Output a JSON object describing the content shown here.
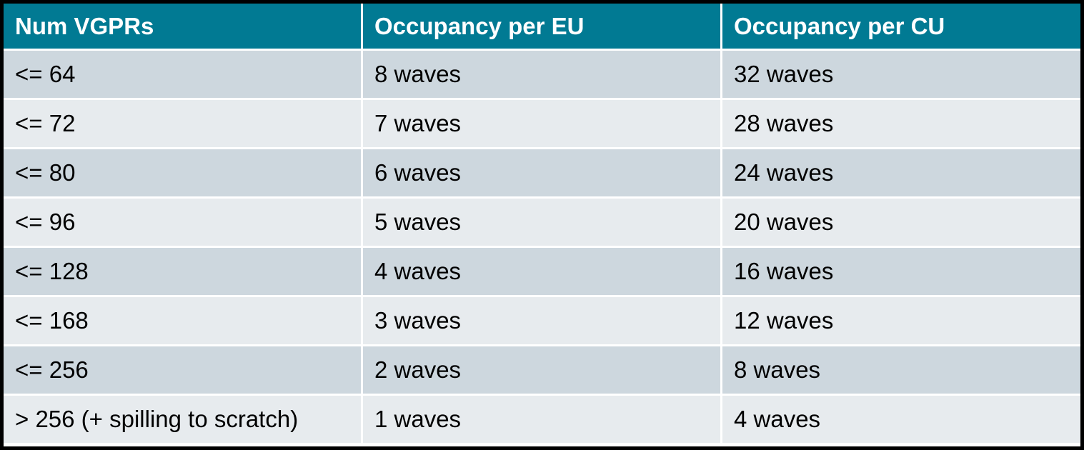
{
  "table": {
    "header_color": "#017A93",
    "row_color_dark": "#CDD7DE",
    "row_color_light": "#E7EBEE",
    "columns": [
      "Num VGPRs",
      "Occupancy per EU",
      "Occupancy per CU"
    ],
    "rows": [
      [
        "<= 64",
        "8 waves",
        "32 waves"
      ],
      [
        "<= 72",
        "7 waves",
        "28 waves"
      ],
      [
        "<= 80",
        "6 waves",
        "24 waves"
      ],
      [
        "<= 96",
        "5 waves",
        "20 waves"
      ],
      [
        "<= 128",
        "4 waves",
        "16 waves"
      ],
      [
        "<= 168",
        "3 waves",
        "12 waves"
      ],
      [
        "<= 256",
        "2 waves",
        "8 waves"
      ],
      [
        "> 256 (+ spilling to scratch)",
        "1 waves",
        "4 waves"
      ]
    ]
  }
}
